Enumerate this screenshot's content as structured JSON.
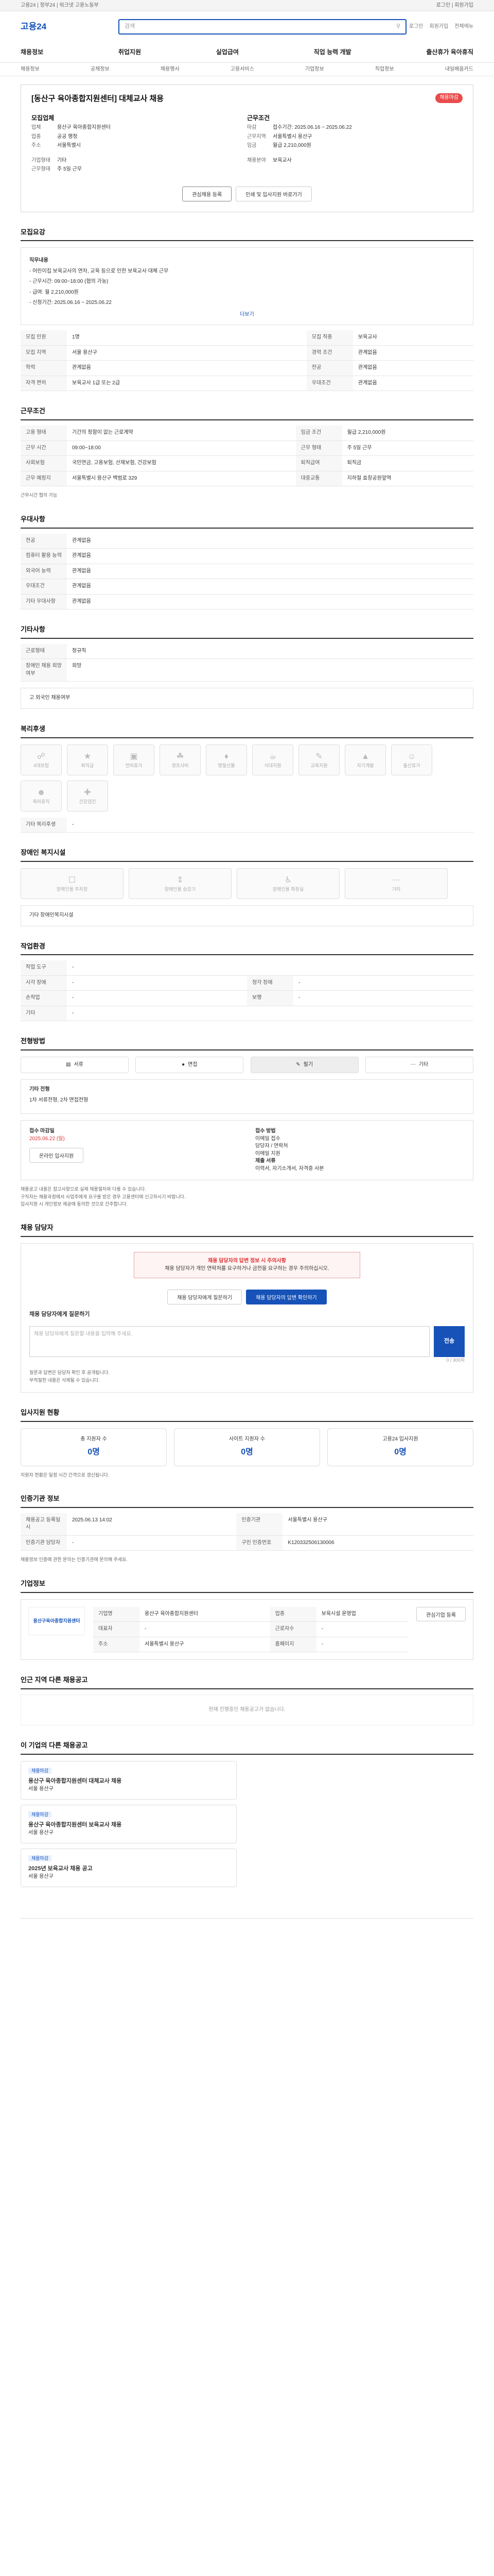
{
  "topbar": {
    "left": "고용24 | 정부24 | 워크넷 고용노동부",
    "right": "로그인 | 회원가입"
  },
  "header": {
    "logo": "고용24",
    "search_placeholder": "검색",
    "util": [
      "로그인",
      "회원가입",
      "전체메뉴"
    ]
  },
  "gnb": [
    "채용정보",
    "취업지원",
    "실업급여",
    "직업 능력 개발",
    "출산휴가 육아휴직"
  ],
  "subnav": [
    "채용정보",
    "공채정보",
    "채용행사",
    "고용서비스",
    "기업정보",
    "직업정보",
    "내일배움카드"
  ],
  "job": {
    "title": "[동산구 육아종합지원센터] 대체교사 채용",
    "badge": "채용마감",
    "company_label": "모집업체",
    "work_label": "근무조건",
    "left": [
      [
        "업체",
        "용산구 육아종합지원센터"
      ],
      [
        "업종",
        "공공 행정"
      ],
      [
        "주소",
        "서울특별시"
      ]
    ],
    "right": [
      [
        "마감",
        "접수기간: 2025.06.16 ~ 2025.06.22"
      ],
      [
        "근무지역",
        "서울특별시 용산구"
      ],
      [
        "임금",
        "월급 2,210,000원"
      ]
    ],
    "ls": [
      [
        "기업형태",
        "기타"
      ],
      [
        "근무형태",
        "주 5일 근무"
      ]
    ],
    "rs": [
      [
        "채용분야",
        "보육교사"
      ]
    ],
    "save": "관심채용 등록",
    "share": "인쇄 및 입사지원 바로가기"
  },
  "overview": {
    "title": "모집요강",
    "lead": [
      "직무내용",
      "- 어린이집 보육교사의 연차, 교육 등으로 인한 보육교사 대체 근무",
      "- 근무시간: 09:00~18:00 (협의 가능)",
      "- 급여: 월 2,210,000원",
      "- 신청기간: 2025.06.16 ~ 2025.06.22"
    ],
    "more": "더보기",
    "rows": [
      [
        "모집 인원",
        "1명",
        "모집 직종",
        "보육교사"
      ],
      [
        "모집 지역",
        "서울 용산구",
        "경력 조건",
        "관계없음"
      ],
      [
        "학력",
        "관계없음",
        "전공",
        "관계없음"
      ],
      [
        "자격 면허",
        "보육교사 1급 또는 2급",
        "우대조건",
        "관계없음"
      ]
    ]
  },
  "condition": {
    "title": "근무조건",
    "rows": [
      [
        "고용 형태",
        "기간의 정함이 없는 근로계약",
        "임금 조건",
        "월급 2,210,000원"
      ],
      [
        "근무 시간",
        "09:00~18:00",
        "근무 형태",
        "주 5일 근무"
      ],
      [
        "사회보험",
        "국민연금, 고용보험, 산재보험, 건강보험",
        "퇴직급여",
        "퇴직금"
      ],
      [
        "근무 예정지",
        "서울특별시 용산구 백범로 329",
        "대중교통",
        "지하철 효창공원앞역"
      ]
    ],
    "note": "근무시간 협의 가능"
  },
  "benefit": {
    "title": "우대사항",
    "rows": [
      [
        "전공",
        "관계없음"
      ],
      [
        "컴퓨터 활용 능력",
        "관계없음"
      ],
      [
        "외국어 능력",
        "관계없음"
      ],
      [
        "우대조건",
        "관계없음"
      ],
      [
        "기타 우대사항",
        "관계없음"
      ]
    ]
  },
  "etc": {
    "title": "기타사항",
    "rows": [
      [
        "근로형태",
        "정규직"
      ],
      [
        "장애인 채용 희망 여부",
        "희망"
      ]
    ],
    "note": "고 외국인 채용여부"
  },
  "welfare": {
    "title": "복리후생",
    "items": [
      "4대보험",
      "퇴직금",
      "연차휴가",
      "경조사비",
      "명절선물",
      "식대지원",
      "교육지원",
      "자기계발",
      "출산휴가",
      "육아휴직",
      "건강검진"
    ],
    "other_label": "기타 복리후생",
    "other": "-"
  },
  "disabled": {
    "title": "장애인 복지시설",
    "items": [
      "장애인용 주차장",
      "장애인용 승강기",
      "장애인용 화장실",
      "기타"
    ],
    "other": "기타 장애인복지시설"
  },
  "workenv": {
    "title": "작업환경",
    "rows": [
      [
        "작업 도구",
        "-"
      ],
      [
        "시각 장애",
        "-",
        "청각 장애",
        "-"
      ],
      [
        "손작업",
        "-",
        "보행",
        "-"
      ],
      [
        "기타",
        "-"
      ]
    ]
  },
  "process": {
    "title": "전형방법",
    "steps": [
      "서류",
      "면접",
      "필기",
      "기타"
    ],
    "text_label": "기타 전형",
    "text": "1차 서류전형, 2차 면접전형"
  },
  "apply": {
    "label1": "접수 마감일",
    "date": "2025.06.22 (일)",
    "label2": "접수 방법",
    "method": "이메일 접수",
    "contact": "담당자 / 연락처",
    "email": "이메일 지원",
    "docs_label": "제출 서류",
    "docs": "이력서, 자기소개서, 자격증 사본",
    "apply_btn": "온라인 입사지원",
    "notices": [
      "채용공고 내용은 참고사항으로 실제 채용절차와 다를 수 있습니다.",
      "구직자는 채용과정에서 사업주에게 요구를 받은 경우 고용센터에 신고하시기 바랍니다.",
      "입사지원 시 개인정보 제공에 동의한 것으로 간주합니다."
    ]
  },
  "manager": {
    "title": "채용 담당자",
    "alert_title": "채용 담당자의 답변 정보 시 주의사항",
    "alert": "채용 담당자가 개인 연락처를 요구하거나 금전을 요구하는 경우 주의하십시오.",
    "btn1": "채용 담당자에게 질문하기",
    "btn2": "채용 담당자의 답변 확인하기",
    "qtitle": "채용 담당자에게 질문하기",
    "qplaceholder": "채용 담당자에게 질문할 내용을 입력해 주세요.",
    "send": "전송",
    "count": "0 / 300자",
    "notes": [
      "질문과 답변은 담당자 확인 후 공개됩니다.",
      "부적절한 내용은 삭제될 수 있습니다."
    ]
  },
  "stats": {
    "title": "입사지원 현황",
    "items": [
      [
        "총 지원자 수",
        "0명"
      ],
      [
        "사이트 지원자 수",
        "0명"
      ],
      [
        "고용24 입사지원",
        "0명"
      ]
    ],
    "note": "지원자 현황은 일정 시간 간격으로 갱신됩니다."
  },
  "info": {
    "title": "인증기관 정보",
    "rows": [
      [
        "채용공고 등록일시",
        "2025.06.13 14:02",
        "인증기관",
        "서울특별시 용산구"
      ],
      [
        "인증기관 담당자",
        "-",
        "구인 인증번호",
        "K120332506130006"
      ]
    ],
    "note": "채용정보 인증에 관한 문의는 인증기관에 문의해 주세요."
  },
  "org": {
    "title": "기업정보",
    "logo": "용산구육아종합지원센터",
    "rows": [
      [
        "기업명",
        "용산구 육아종합지원센터",
        "업종",
        "보육시설 운영업"
      ],
      [
        "대표자",
        "-",
        "근로자수",
        "-"
      ],
      [
        "주소",
        "서울특별시 용산구",
        "홈페이지",
        "-"
      ]
    ],
    "btn": "관심기업 등록"
  },
  "nearby": {
    "title": "인근 지역 다른 채용공고",
    "empty": "현재 진행중인 채용공고가 없습니다."
  },
  "others": {
    "title": "이 기업의 다른 채용공고",
    "cards": [
      [
        "채용마감",
        "용산구 육아종합지원센터 대체교사 채용",
        "서울 용산구"
      ],
      [
        "채용마감",
        "용산구 육아종합지원센터 보육교사 채용",
        "서울 용산구"
      ],
      [
        "채용마감",
        "2025년 보육교사 채용 공고",
        "서울 용산구"
      ]
    ]
  }
}
